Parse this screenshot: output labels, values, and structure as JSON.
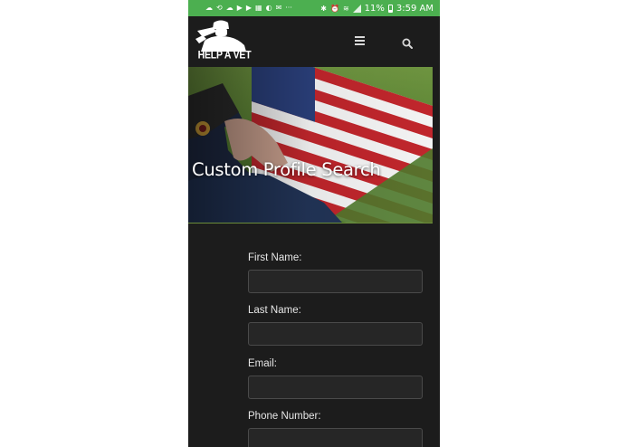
{
  "status_bar": {
    "left_icons": [
      "cloud-icon",
      "sync-icon",
      "cloud-icon",
      "youtube-icon",
      "youtube-icon",
      "calendar-icon",
      "android-icon",
      "gmail-icon",
      "more-icon"
    ],
    "more": "···",
    "battery": "11%",
    "time": "3:59 AM",
    "color": "#4caf50"
  },
  "header": {
    "logo_text": "HELP A VET",
    "menu_icon": "hamburger-menu-icon",
    "search_icon": "search-icon"
  },
  "hero": {
    "title": "Custom Profile Search"
  },
  "form": {
    "fields": [
      {
        "label": "First Name:",
        "value": ""
      },
      {
        "label": "Last Name:",
        "value": ""
      },
      {
        "label": "Email:",
        "value": ""
      },
      {
        "label": "Phone Number:",
        "value": ""
      }
    ]
  }
}
